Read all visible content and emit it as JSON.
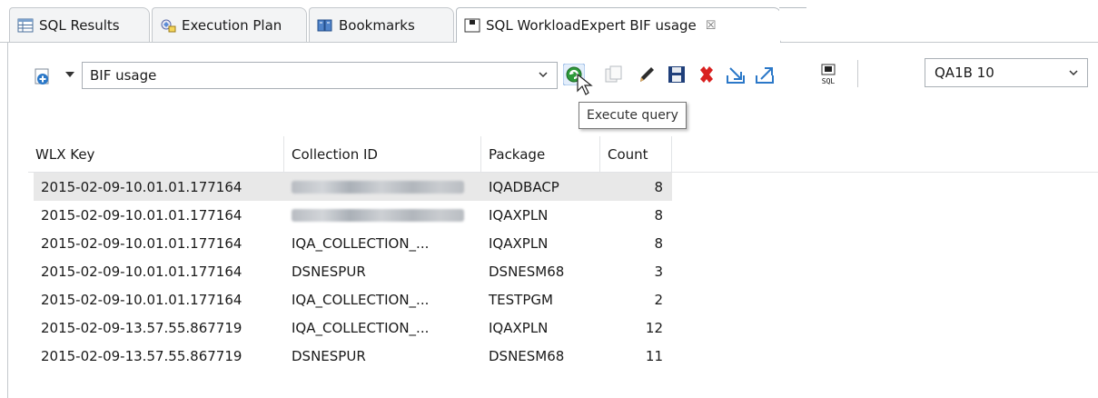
{
  "tabs": [
    {
      "label": "SQL Results",
      "icon": "table-icon"
    },
    {
      "label": "Execution Plan",
      "icon": "execution-plan-icon"
    },
    {
      "label": "Bookmarks",
      "icon": "bookmarks-icon"
    },
    {
      "label": "SQL WorkloadExpert BIF usage",
      "icon": "editor-tab-icon",
      "close": "☒",
      "active": true
    }
  ],
  "toolbar": {
    "query_combo_value": "BIF usage",
    "subsystem_combo_value": "QA1B 10",
    "tooltip": "Execute query",
    "buttons": [
      "execute-query",
      "copy",
      "edit",
      "save",
      "delete",
      "import",
      "export",
      "sql"
    ]
  },
  "table": {
    "columns": [
      "WLX Key",
      "Collection ID",
      "Package",
      "Count"
    ],
    "rows": [
      {
        "wlx_key": "2015-02-09-10.01.01.177164",
        "collection_id": "",
        "collection_redacted": true,
        "package": "IQADBACP",
        "count": "8",
        "selected": true
      },
      {
        "wlx_key": "2015-02-09-10.01.01.177164",
        "collection_id": "",
        "collection_redacted": true,
        "package": "IQAXPLN",
        "count": "8"
      },
      {
        "wlx_key": "2015-02-09-10.01.01.177164",
        "collection_id": "IQA_COLLECTION_...",
        "package": "IQAXPLN",
        "count": "8"
      },
      {
        "wlx_key": "2015-02-09-10.01.01.177164",
        "collection_id": "DSNESPUR",
        "package": "DSNESM68",
        "count": "3"
      },
      {
        "wlx_key": "2015-02-09-10.01.01.177164",
        "collection_id": "IQA_COLLECTION_...",
        "package": "TESTPGM",
        "count": "2"
      },
      {
        "wlx_key": "2015-02-09-13.57.55.867719",
        "collection_id": "IQA_COLLECTION_...",
        "package": "IQAXPLN",
        "count": "12"
      },
      {
        "wlx_key": "2015-02-09-13.57.55.867719",
        "collection_id": "DSNESPUR",
        "package": "DSNESM68",
        "count": "11"
      }
    ]
  },
  "colors": {
    "execute_green": "#2e9a3a",
    "delete_red": "#d9201f",
    "save_navy": "#1f3f7a",
    "selected_row": "#e8e8e8"
  }
}
